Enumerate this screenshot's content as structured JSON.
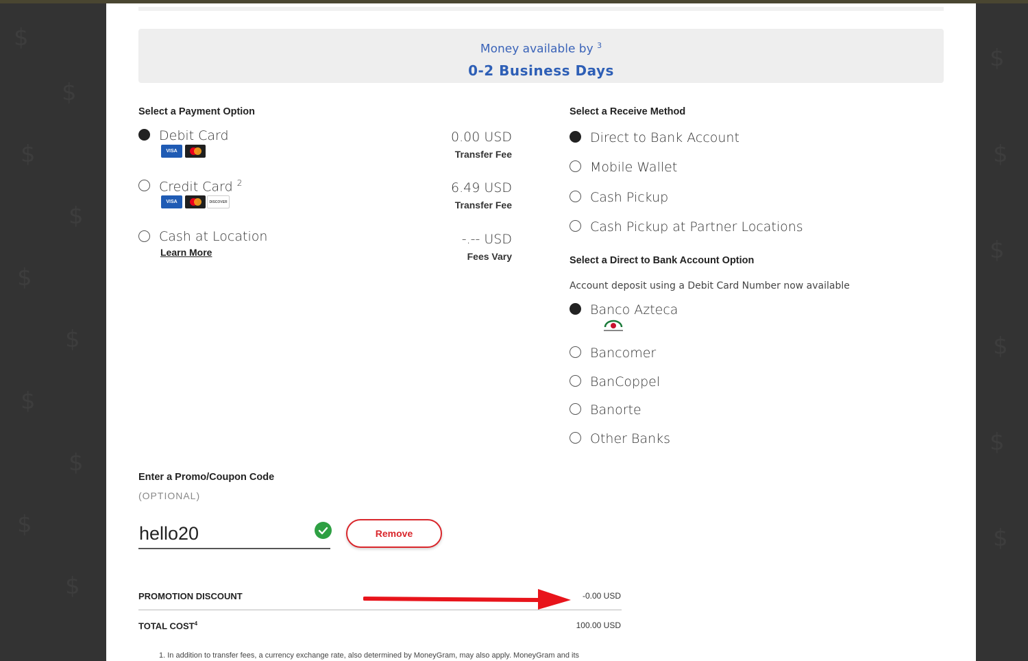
{
  "availability": {
    "label": "Money available by",
    "footnote_ref": "3",
    "value": "0-2 Business Days"
  },
  "payment": {
    "title": "Select a Payment Option",
    "options": [
      {
        "label": "Debit Card",
        "sup": "",
        "selected": true,
        "amount": "0.00 USD",
        "fee_label": "Transfer Fee",
        "logos": [
          "visa",
          "mastercard"
        ]
      },
      {
        "label": "Credit Card",
        "sup": "2",
        "selected": false,
        "amount": "6.49 USD",
        "fee_label": "Transfer Fee",
        "logos": [
          "visa",
          "mastercard",
          "discover"
        ]
      },
      {
        "label": "Cash at Location",
        "sup": "",
        "selected": false,
        "amount": "-.-- USD",
        "fee_label": "Fees Vary",
        "link": "Learn More"
      }
    ],
    "logo_text": {
      "visa": "VISA",
      "discover": "DISCOVER"
    }
  },
  "receive": {
    "title": "Select a Receive Method",
    "options": [
      {
        "label": "Direct to Bank Account",
        "selected": true
      },
      {
        "label": "Mobile Wallet",
        "selected": false
      },
      {
        "label": "Cash Pickup",
        "selected": false
      },
      {
        "label": "Cash Pickup at Partner Locations",
        "selected": false
      }
    ]
  },
  "bank": {
    "title": "Select a Direct to Bank Account Option",
    "info": "Account deposit using a Debit Card Number now available",
    "options": [
      {
        "label": "Banco Azteca",
        "selected": true
      },
      {
        "label": "Bancomer",
        "selected": false
      },
      {
        "label": "BanCoppel",
        "selected": false
      },
      {
        "label": "Banorte",
        "selected": false
      },
      {
        "label": "Other Banks",
        "selected": false
      }
    ]
  },
  "promo": {
    "title": "Enter a Promo/Coupon Code",
    "optional": "(OPTIONAL)",
    "value": "hello20",
    "remove_label": "Remove"
  },
  "summary": {
    "discount_label": "PROMOTION DISCOUNT",
    "discount_value": "-0.00 USD",
    "total_label": "TOTAL COST",
    "total_sup": "4",
    "total_value": "100.00 USD"
  },
  "footnote": "1. In addition to transfer fees, a currency exchange rate, also determined by MoneyGram, may also apply. MoneyGram and its",
  "colors": {
    "accent_blue": "#2e5fb6",
    "remove_red": "#d9262b",
    "check_green": "#2ea043",
    "arrow_red": "#e8141b"
  }
}
